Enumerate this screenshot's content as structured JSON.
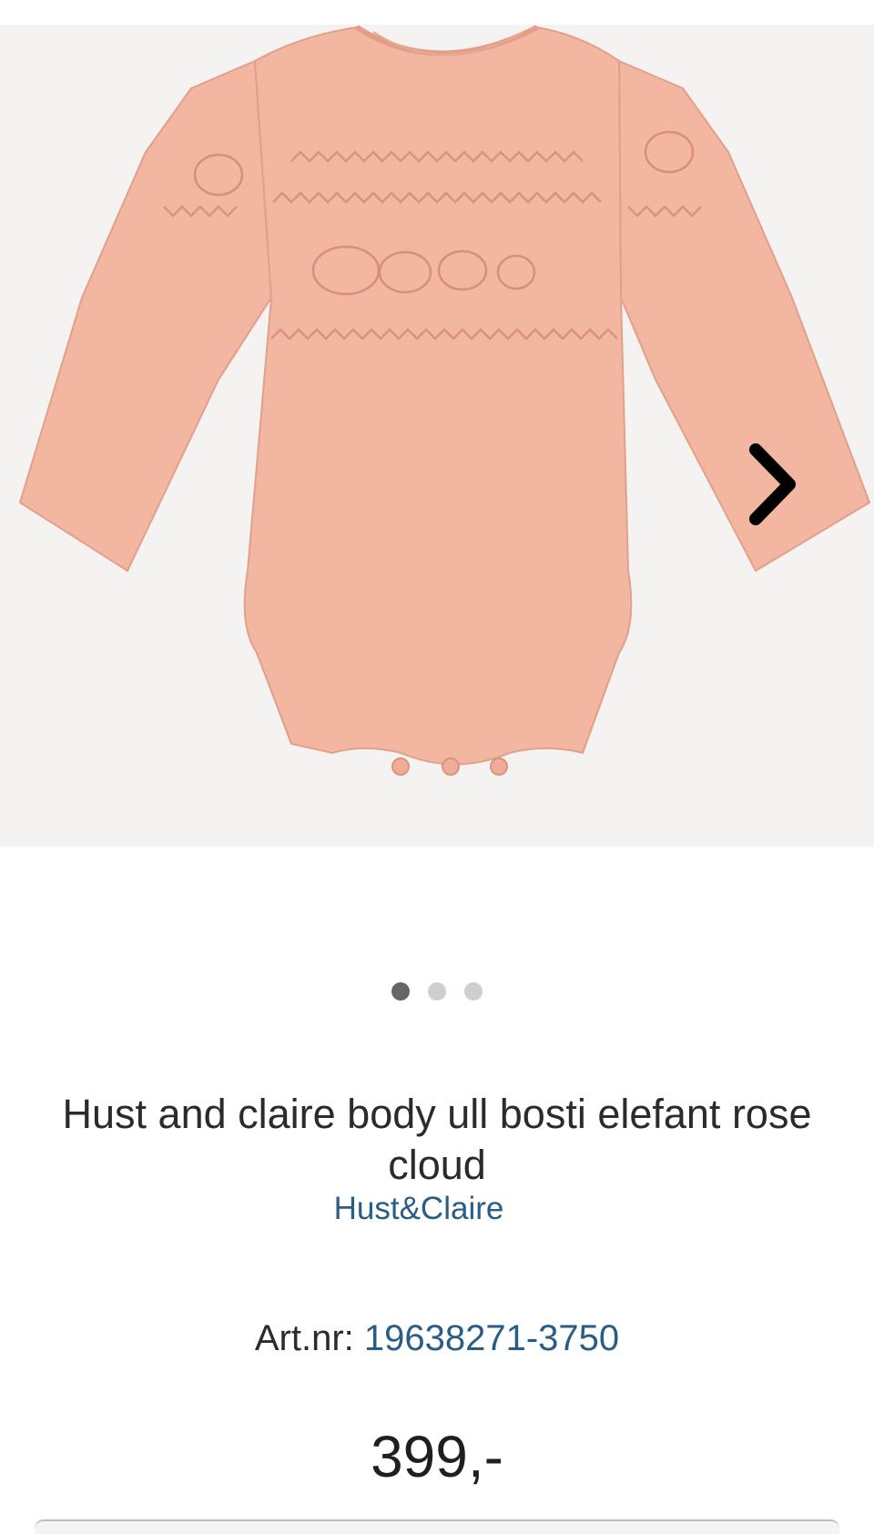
{
  "product": {
    "title": "Hust and claire body ull bosti elefant rose cloud",
    "brand": "Hust&Claire",
    "art_label": "Art.nr:",
    "art_number": "19638271-3750",
    "price": "399,-",
    "image_color": "#f2b6a1"
  },
  "gallery": {
    "slide_count": 3,
    "active_slide": 1,
    "next_icon": "chevron-right-icon"
  },
  "colors": {
    "accent": "#2a5d86",
    "gallery_bg": "#f5f3f1",
    "dot_active": "#666666",
    "dot_inactive": "#cfcfcf"
  }
}
